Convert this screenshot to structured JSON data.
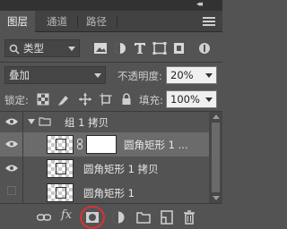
{
  "topbar": {
    "collapse_glyph": "◂◂",
    "close_glyph": "x"
  },
  "tabs": [
    {
      "label": "图层",
      "active": true
    },
    {
      "label": "通道",
      "active": false
    },
    {
      "label": "路径",
      "active": false
    }
  ],
  "panel_menu_icon": "hamburger-icon",
  "filter": {
    "prefix_icon": "search-icon",
    "selected": "类型",
    "type_icons": [
      "image-filter-icon",
      "adjustment-filter-icon",
      "type-filter-icon",
      "shape-filter-icon",
      "smart-object-filter-icon"
    ]
  },
  "blend": {
    "mode": "叠加",
    "opacity_label": "不透明度:",
    "opacity_value": "20%"
  },
  "lock": {
    "label": "锁定:",
    "icons": [
      "lock-transparency-icon",
      "lock-image-icon",
      "lock-position-icon",
      "lock-artboard-icon",
      "lock-all-icon"
    ],
    "fill_label": "填充:",
    "fill_value": "100%"
  },
  "layers": [
    {
      "name": "组 1 拷贝",
      "type": "group",
      "visible": true,
      "expanded": true,
      "selected": false
    },
    {
      "name": "圆角矩形 1 ...",
      "type": "shape-with-mask",
      "visible": true,
      "selected": true
    },
    {
      "name": "圆角矩形 1 拷贝",
      "type": "shape",
      "visible": true,
      "selected": false
    },
    {
      "name": "圆角矩形 1",
      "type": "shape",
      "visible": false,
      "selected": false
    }
  ],
  "bottom_icons": [
    "link-layers-icon",
    "fx-icon",
    "add-mask-icon",
    "adjustment-layer-icon",
    "new-group-icon",
    "new-layer-icon",
    "delete-icon"
  ],
  "bottom_fx_label": "fx",
  "highlight_color": "#e03030"
}
